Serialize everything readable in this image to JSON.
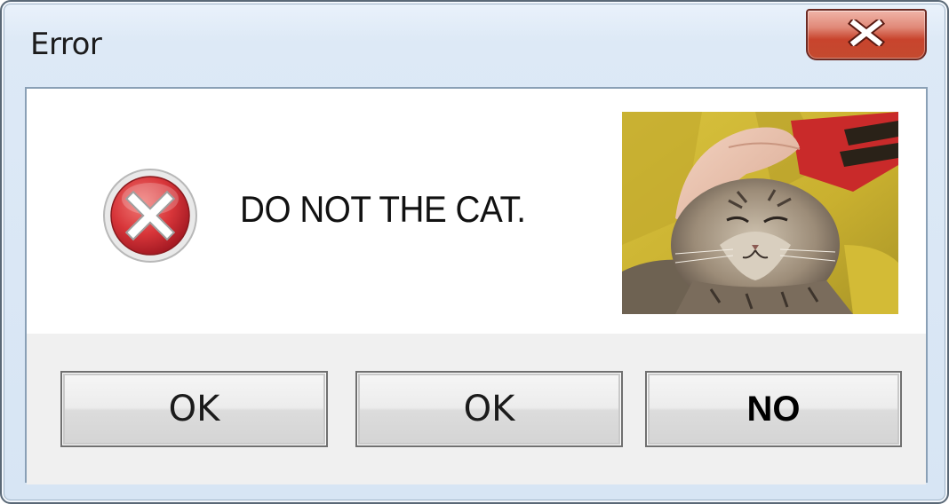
{
  "window": {
    "title": "Error"
  },
  "titlebar": {
    "close_icon": "close-icon",
    "close_color": "#c8442d"
  },
  "dialog": {
    "icon": "error-icon",
    "icon_color": "#c4262e",
    "message": "DO NOT THE CAT.",
    "image": "cat-photo"
  },
  "buttons": {
    "ok1_label": "OK",
    "ok2_label": "OK",
    "no_label": "NO"
  }
}
